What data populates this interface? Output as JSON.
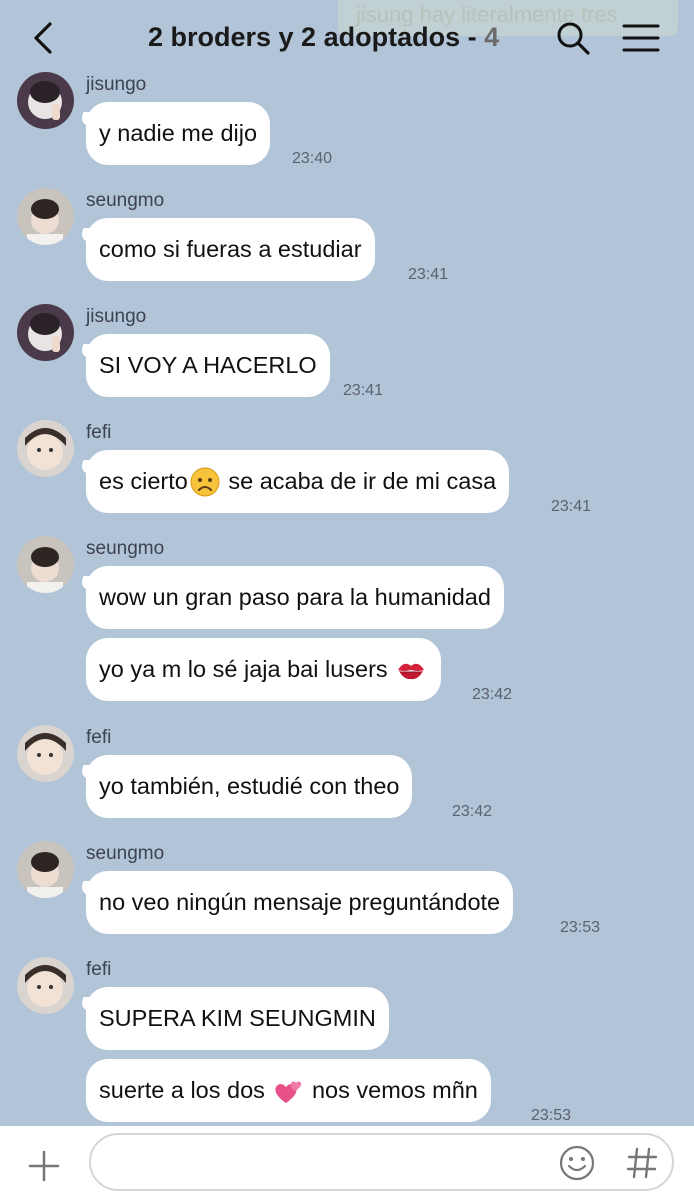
{
  "header": {
    "title": "2 broders y 2 adoptados - ",
    "member_count": "4",
    "notification_preview": "jisung hay literalmente tres"
  },
  "messages": [
    {
      "sender": "jisungo",
      "text": "y nadie me dijo",
      "time": "23:40"
    },
    {
      "sender": "seungmo",
      "text": "como si fueras a estudiar",
      "time": "23:41"
    },
    {
      "sender": "jisungo",
      "text": "SI VOY A HACERLO",
      "time": "23:41"
    },
    {
      "sender": "fefi",
      "text_before": "es cierto",
      "emoji": "worried-face",
      "text_after": " se acaba de ir de mi casa",
      "time": "23:41"
    },
    {
      "sender": "seungmo",
      "text": "wow un gran paso para la humanidad"
    },
    {
      "text": "yo ya m lo sé jaja bai lusers ",
      "emoji": "kiss-mark",
      "time": "23:42"
    },
    {
      "sender": "fefi",
      "text": "yo también, estudié con theo",
      "time": "23:42"
    },
    {
      "sender": "seungmo",
      "text": "no veo ningún mensaje preguntándote",
      "time": "23:53"
    },
    {
      "sender": "fefi",
      "text": "SUPERA KIM SEUNGMIN"
    },
    {
      "text_before": "suerte a los dos ",
      "emoji": "two-hearts",
      "text_after": " nos vemos mñn",
      "time": "23:53"
    }
  ],
  "colors": {
    "background": "#b2c4d7",
    "bubble": "#ffffff",
    "timestamp": "#5b6270"
  }
}
